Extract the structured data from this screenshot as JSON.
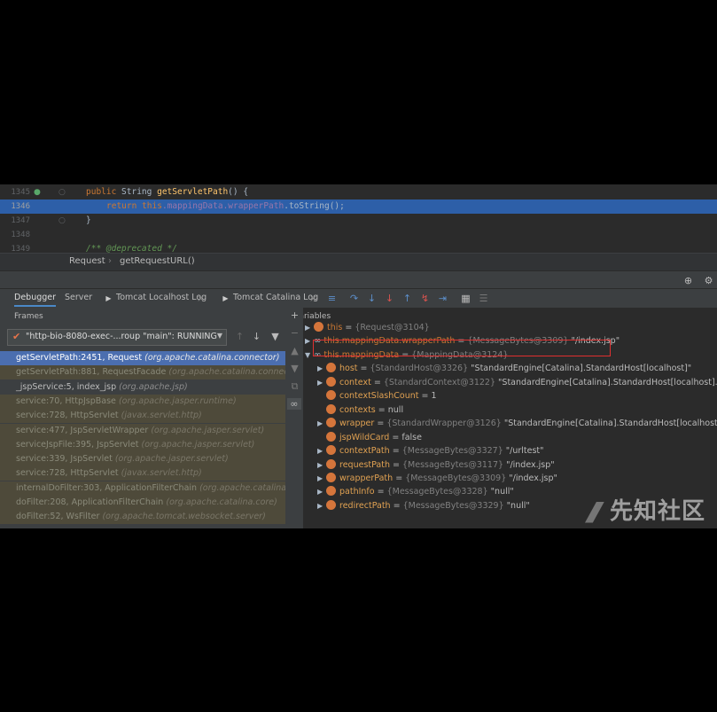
{
  "editor": {
    "lines": [
      {
        "num": "1345",
        "code_kw": "public ",
        "code_type": "String ",
        "code_fn": "getServletPath",
        "code_rest": "() {"
      },
      {
        "num": "1346",
        "return_kw": "return ",
        "this_kw": "this",
        "field1": ".mappingData",
        "field2": ".wrapperPath",
        "rest": ".toString();"
      },
      {
        "num": "1347",
        "code": "}"
      },
      {
        "num": "1348",
        "code": ""
      },
      {
        "num": "1349",
        "comment": "/** @deprecated */"
      }
    ]
  },
  "breadcrumb": {
    "items": [
      "Request",
      "getRequestURL()"
    ]
  },
  "debugger": {
    "tabs": [
      "Debugger",
      "Server",
      "Tomcat Localhost Log",
      "Tomcat Catalina Log"
    ],
    "frames_title": "Frames",
    "variables_title": "Variables",
    "thread": "\"http-bio-8080-exec-...roup \"main\": RUNNING",
    "frames": [
      {
        "method": "getServletPath:2451, Request",
        "pkg": "(org.apache.catalina.connector)",
        "style": "sel"
      },
      {
        "method": "getServletPath:881, RequestFacade",
        "pkg": "(org.apache.catalina.connector)",
        "style": "lib"
      },
      {
        "method": "_jspService:5, index_jsp",
        "pkg": "(org.apache.jsp)",
        "style": "normal"
      },
      {
        "method": "service:70, HttpJspBase",
        "pkg": "(org.apache.jasper.runtime)",
        "style": "lib"
      },
      {
        "method": "service:728, HttpServlet",
        "pkg": "(javax.servlet.http)",
        "style": "lib"
      },
      {
        "method": "service:477, JspServletWrapper",
        "pkg": "(org.apache.jasper.servlet)",
        "style": "lib"
      },
      {
        "method": "serviceJspFile:395, JspServlet",
        "pkg": "(org.apache.jasper.servlet)",
        "style": "lib"
      },
      {
        "method": "service:339, JspServlet",
        "pkg": "(org.apache.jasper.servlet)",
        "style": "lib"
      },
      {
        "method": "service:728, HttpServlet",
        "pkg": "(javax.servlet.http)",
        "style": "lib"
      },
      {
        "method": "internalDoFilter:303, ApplicationFilterChain",
        "pkg": "(org.apache.catalina.co",
        "style": "lib"
      },
      {
        "method": "doFilter:208, ApplicationFilterChain",
        "pkg": "(org.apache.catalina.core)",
        "style": "lib"
      },
      {
        "method": "doFilter:52, WsFilter",
        "pkg": "(org.apache.tomcat.websocket.server)",
        "style": "lib"
      }
    ],
    "variables": [
      {
        "indent": 0,
        "arrow": "▶",
        "icon": "orange",
        "name": "this",
        "type": "{Request@3104}",
        "value": ""
      },
      {
        "indent": 0,
        "arrow": "▶",
        "icon": "oo",
        "name": "this.mappingData.wrapperPath",
        "type": "{MessageBytes@3309}",
        "value": "\"/index.jsp\""
      },
      {
        "indent": 0,
        "arrow": "▼",
        "icon": "oo",
        "name": "this.mappingData",
        "type": "{MappingData@3124}",
        "value": ""
      },
      {
        "indent": 1,
        "arrow": "▶",
        "icon": "orange",
        "name": "host",
        "type": "{StandardHost@3326}",
        "value": "\"StandardEngine[Catalina].StandardHost[localhost]\""
      },
      {
        "indent": 1,
        "arrow": "▶",
        "icon": "orange",
        "name": "context",
        "type": "{StandardContext@3122}",
        "value": "\"StandardEngine[Catalina].StandardHost[localhost].Star"
      },
      {
        "indent": 1,
        "arrow": "",
        "icon": "orange",
        "name": "contextSlashCount",
        "type": "",
        "value": "1"
      },
      {
        "indent": 1,
        "arrow": "",
        "icon": "orange",
        "name": "contexts",
        "type": "",
        "value": "null"
      },
      {
        "indent": 1,
        "arrow": "▶",
        "icon": "orange",
        "name": "wrapper",
        "type": "{StandardWrapper@3126}",
        "value": "\"StandardEngine[Catalina].StandardHost[localhost].St"
      },
      {
        "indent": 1,
        "arrow": "",
        "icon": "orange",
        "name": "jspWildCard",
        "type": "",
        "value": "false"
      },
      {
        "indent": 1,
        "arrow": "▶",
        "icon": "orange",
        "name": "contextPath",
        "type": "{MessageBytes@3327}",
        "value": "\"/urltest\""
      },
      {
        "indent": 1,
        "arrow": "▶",
        "icon": "orange",
        "name": "requestPath",
        "type": "{MessageBytes@3117}",
        "value": "\"/index.jsp\""
      },
      {
        "indent": 1,
        "arrow": "▶",
        "icon": "orange",
        "name": "wrapperPath",
        "type": "{MessageBytes@3309}",
        "value": "\"/index.jsp\""
      },
      {
        "indent": 1,
        "arrow": "▶",
        "icon": "orange",
        "name": "pathInfo",
        "type": "{MessageBytes@3328}",
        "value": "\"null\""
      },
      {
        "indent": 1,
        "arrow": "▶",
        "icon": "orange",
        "name": "redirectPath",
        "type": "{MessageBytes@3329}",
        "value": "\"null\""
      }
    ]
  },
  "watermark": "先知社区"
}
